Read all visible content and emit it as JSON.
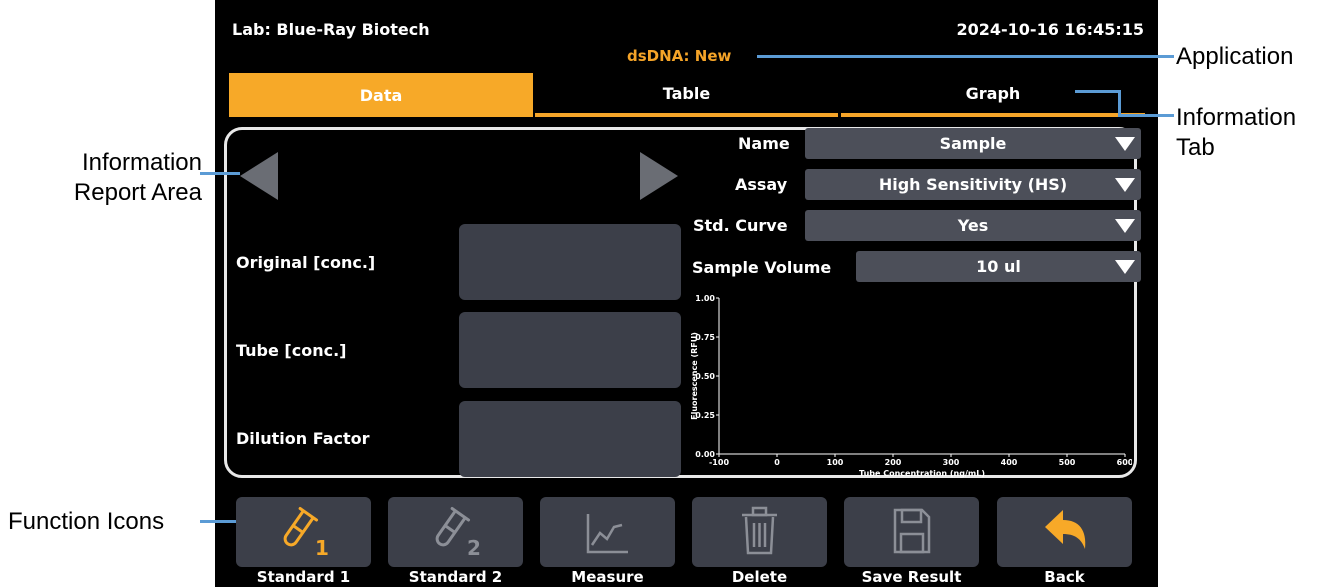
{
  "header": {
    "lab": "Lab: Blue-Ray Biotech",
    "datetime": "2024-10-16 16:45:15",
    "application": "dsDNA: New"
  },
  "tabs": [
    {
      "label": "Data",
      "active": true
    },
    {
      "label": "Table",
      "active": false
    },
    {
      "label": "Graph",
      "active": false
    }
  ],
  "report": {
    "fields": [
      {
        "label": "Original [conc.]",
        "value": ""
      },
      {
        "label": "Tube [conc.]",
        "value": ""
      },
      {
        "label": "Dilution Factor",
        "value": ""
      }
    ],
    "settings": [
      {
        "label": "Name",
        "value": "Sample"
      },
      {
        "label": "Assay",
        "value": "High Sensitivity (HS)"
      },
      {
        "label": "Std. Curve",
        "value": "Yes"
      },
      {
        "label": "Sample Volume",
        "value": "10 ul"
      }
    ]
  },
  "chart_data": {
    "type": "scatter",
    "xlabel": "Tube Concentration (ng/mL)",
    "ylabel": "Fluorescence (RFU)",
    "xlim": [
      -100,
      600
    ],
    "ylim": [
      0,
      1
    ],
    "xticks": [
      "-100",
      "0",
      "100",
      "200",
      "300",
      "400",
      "500",
      "600"
    ],
    "yticks": [
      "0.00",
      "0.25",
      "0.50",
      "0.75",
      "1.00"
    ],
    "series": []
  },
  "functions": [
    {
      "label": "Standard 1",
      "icon": "test-tube-1-icon",
      "enabled": true
    },
    {
      "label": "Standard 2",
      "icon": "test-tube-2-icon",
      "enabled": false
    },
    {
      "label": "Measure",
      "icon": "line-graph-icon",
      "enabled": false
    },
    {
      "label": "Delete",
      "icon": "trash-icon",
      "enabled": false
    },
    {
      "label": "Save Result",
      "icon": "floppy-disk-icon",
      "enabled": false
    },
    {
      "label": "Back",
      "icon": "back-arrow-icon",
      "enabled": true
    }
  ],
  "annotations": {
    "application": "Application",
    "information_tab": "Information\nTab",
    "report_area": "Information\nReport Area",
    "function_icons": "Function Icons"
  },
  "colors": {
    "accent": "#f7a928",
    "panel": "#3c3f49",
    "dropdown": "#4c4f59",
    "annotation_line": "#5b9bd5"
  }
}
